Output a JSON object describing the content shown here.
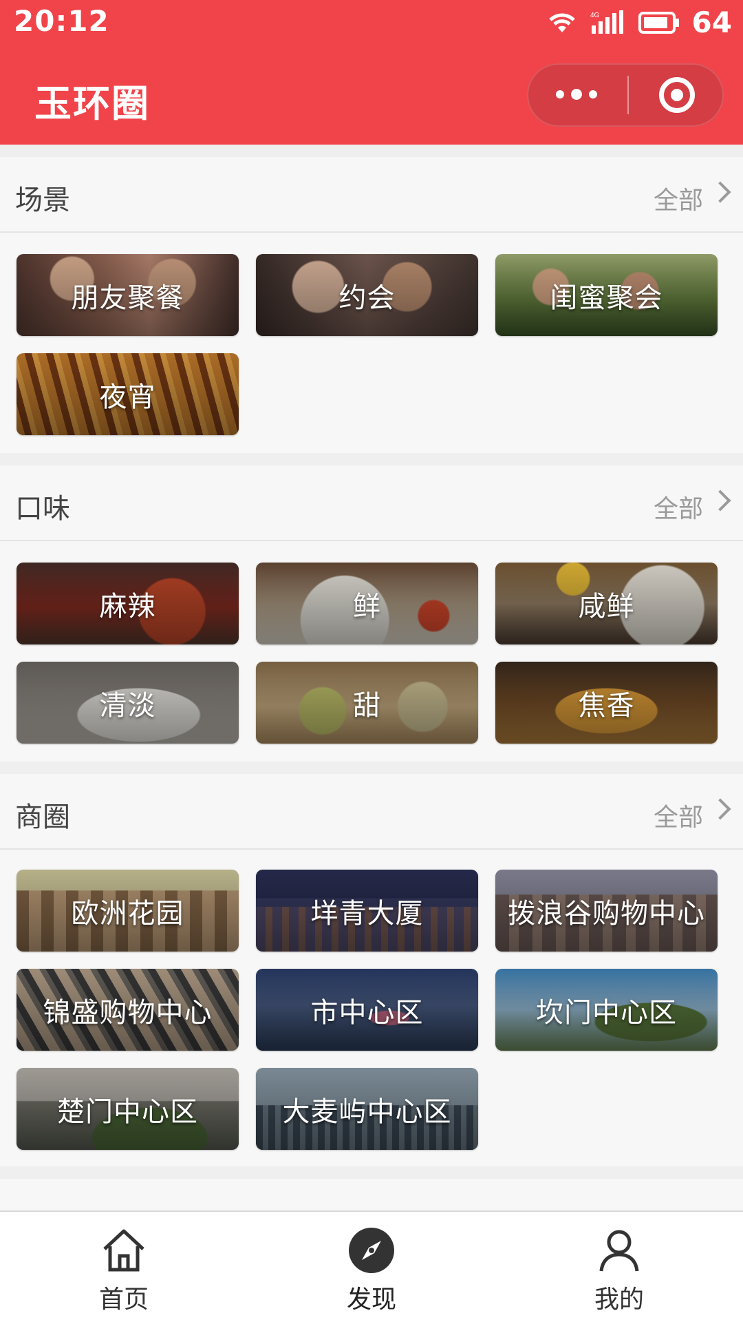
{
  "status_bar": {
    "time": "20:12",
    "battery": "64",
    "network": "4G"
  },
  "app": {
    "title": "玉环圈"
  },
  "sections": [
    {
      "title": "场景",
      "all_label": "全部",
      "items": [
        {
          "label": "朋友聚餐"
        },
        {
          "label": "约会"
        },
        {
          "label": "闺蜜聚会"
        },
        {
          "label": "夜宵"
        }
      ]
    },
    {
      "title": "口味",
      "all_label": "全部",
      "items": [
        {
          "label": "麻辣"
        },
        {
          "label": "鲜"
        },
        {
          "label": "咸鲜"
        },
        {
          "label": "清淡"
        },
        {
          "label": "甜"
        },
        {
          "label": "焦香"
        }
      ]
    },
    {
      "title": "商圈",
      "all_label": "全部",
      "items": [
        {
          "label": "欧洲花园"
        },
        {
          "label": "垟青大厦"
        },
        {
          "label": "拨浪谷购物中心"
        },
        {
          "label": "锦盛购物中心"
        },
        {
          "label": "市中心区"
        },
        {
          "label": "坎门中心区"
        },
        {
          "label": "楚门中心区"
        },
        {
          "label": "大麦屿中心区"
        }
      ]
    }
  ],
  "bottom_nav": [
    {
      "label": "首页",
      "icon": "home-icon"
    },
    {
      "label": "发现",
      "icon": "compass-icon"
    },
    {
      "label": "我的",
      "icon": "user-icon"
    }
  ],
  "colors": {
    "brand": "#f0444a",
    "background": "#f7f7f7"
  }
}
